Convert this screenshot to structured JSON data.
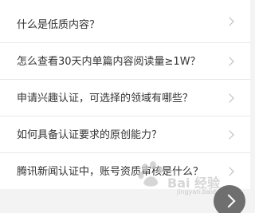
{
  "questions": [
    {
      "text": "什么是低质内容？"
    },
    {
      "text": "怎么查看30天内单篇内容阅读量≥1W？"
    },
    {
      "text": "申请兴趣认证，可选择的领域有哪些？"
    },
    {
      "text": "如何具备认证要求的原创能力？"
    },
    {
      "text": "腾讯新闻认证中，账号资质审核是什么？"
    }
  ],
  "watermark": {
    "text": "Bai 经验",
    "url": "jingyan.baidu.com"
  },
  "icons": {
    "item_chevron": "chevron-right-icon",
    "fab": "chevron-right-icon",
    "watermark_logo": "baidu-paw-logo"
  },
  "colors": {
    "text": "#333333",
    "chevron": "#b8b8b8",
    "divider": "#e9e9e9",
    "fab": "#6f6f6f"
  }
}
